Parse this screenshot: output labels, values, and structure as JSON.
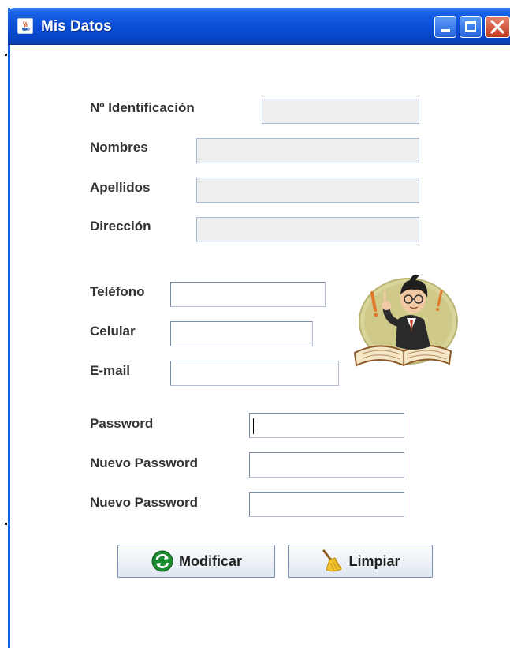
{
  "window": {
    "title": "Mis Datos"
  },
  "form": {
    "identificacion_label": "Nº Identificación",
    "nombres_label": "Nombres",
    "apellidos_label": "Apellidos",
    "direccion_label": "Dirección",
    "telefono_label": "Teléfono",
    "celular_label": "Celular",
    "email_label": "E-mail",
    "password_label": "Password",
    "nuevo_password_label": "Nuevo Password",
    "nuevo_password2_label": "Nuevo Password"
  },
  "buttons": {
    "modificar": "Modificar",
    "limpiar": "Limpiar"
  },
  "icons": {
    "window_icon": "java-cup-icon",
    "modificar_icon": "refresh-icon",
    "limpiar_icon": "broom-icon",
    "avatar": "student-reading-book-illustration"
  },
  "colors": {
    "titlebar": "#0a4fd6",
    "disabled_field": "#eeeeee",
    "label_text": "#333333"
  }
}
